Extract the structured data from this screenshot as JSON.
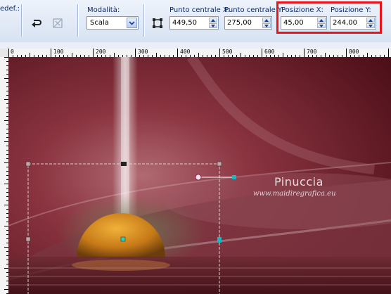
{
  "toolbar": {
    "preset_label": "edef.:",
    "mode_label": "Modalità:",
    "mode_value": "Scala",
    "center_x_label": "Punto centrale X:",
    "center_x_value": "449,50",
    "center_y_label": "Punto centrale Y:",
    "center_y_value": "275,00",
    "pos_x_label": "Posizione X:",
    "pos_x_value": "45,00",
    "pos_y_label": "Posizione Y:",
    "pos_y_value": "244,00",
    "highlight_color": "#e8141b"
  },
  "ruler": {
    "h_ticks": [
      "0",
      "100",
      "200",
      "300",
      "400",
      "500",
      "600",
      "700",
      "800"
    ],
    "v_ticks": [
      "0",
      "100",
      "200",
      "300",
      "400",
      "500"
    ]
  },
  "canvas": {
    "watermark_name": "Pinuccia",
    "watermark_url": "www.maidiregrafica.eu",
    "background_color": "#6b1d27"
  }
}
